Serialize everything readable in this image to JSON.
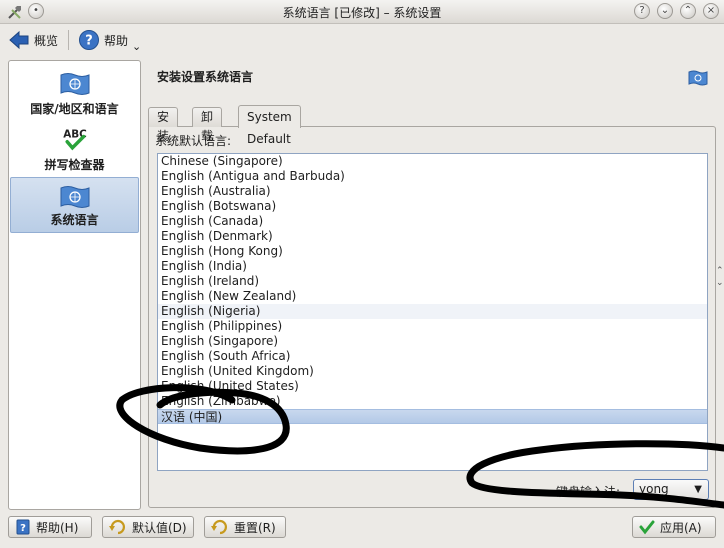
{
  "window": {
    "title": "系统语言 [已修改] – 系统设置"
  },
  "toolbar": {
    "overview_label": "概览",
    "help_label": "帮助",
    "help_arrow": "⌄"
  },
  "sidebar": {
    "items": [
      {
        "label": "国家/地区和语言",
        "icon": "flag-icon"
      },
      {
        "label": "拼写检查器",
        "icon": "spellcheck-icon"
      },
      {
        "label": "系统语言",
        "icon": "flag-icon"
      }
    ],
    "selected_index": 2
  },
  "main": {
    "title": "安装设置系统语言",
    "tabs": [
      {
        "label": "安装"
      },
      {
        "label": "卸载"
      },
      {
        "label": "System Default"
      }
    ],
    "active_tab": 2,
    "list_label": "系统默认语言:",
    "languages": [
      "Chinese (Singapore)",
      "English (Antigua and Barbuda)",
      "English (Australia)",
      "English (Botswana)",
      "English (Canada)",
      "English (Denmark)",
      "English (Hong Kong)",
      "English (India)",
      "English (Ireland)",
      "English (New Zealand)",
      "English (Nigeria)",
      "English (Philippines)",
      "English (Singapore)",
      "English (South Africa)",
      "English (United Kingdom)",
      "English (United States)",
      "English (Zimbabwe)",
      "汉语 (中国)"
    ],
    "selected_language": "汉语 (中国)",
    "keyboard_label": "键盘输入法:",
    "keyboard_value": "yong"
  },
  "buttons": {
    "help": "帮助(H)",
    "defaults": "默认值(D)",
    "reset": "重置(R)",
    "apply": "应用(A)"
  },
  "colors": {
    "selection": "#b9cde6",
    "accent": "#3a6fb8",
    "scribble": "#000000"
  }
}
